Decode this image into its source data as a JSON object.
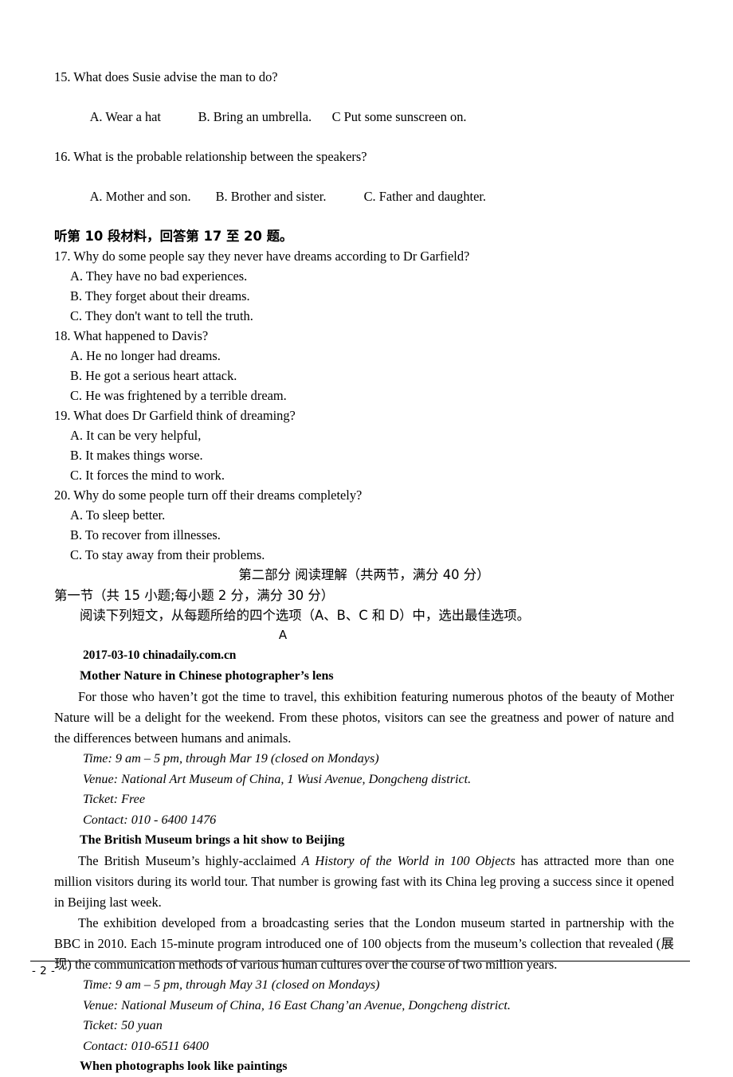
{
  "document": {
    "page_number_label": "- 2 -"
  },
  "listening": {
    "questions": [
      {
        "number": "15.",
        "text": "15. What does Susie advise the man to do?",
        "options": [
          "A. Wear a hat",
          "B. Bring an umbrella.",
          "C Put some sunscreen on."
        ],
        "inline": true
      },
      {
        "number": "16.",
        "text": "16. What is the probable relationship between the speakers?",
        "options": [
          "A. Mother and son.",
          "B. Brother and sister.",
          "C. Father and daughter."
        ],
        "inline": true
      }
    ],
    "instruction_10": "听第 10 段材料，回答第 17 至 20 题。",
    "q17": {
      "stem": "17. Why do some people say they never have dreams according to Dr Garfield?",
      "a": "A. They have no bad experiences.",
      "b": "B. They forget about their dreams.",
      "c": "C. They don't want to tell the truth."
    },
    "q18": {
      "stem": "18. What happened to Davis?",
      "a": "A. He no longer had dreams.",
      "b": "B. He got a serious heart attack.",
      "c": "C. He was frightened by a terrible dream."
    },
    "q19": {
      "stem": "19. What does Dr Garfield think of dreaming?",
      "a": "A. It can be very helpful,",
      "b": "B. It makes things worse.",
      "c": "C. It forces the mind to work."
    },
    "q20": {
      "stem": "20. Why do some people turn off their dreams completely?",
      "a": "A. To sleep better.",
      "b": "B. To recover from illnesses.",
      "c": "C. To stay away from their problems."
    }
  },
  "part_two": {
    "heading": "第二部分   阅读理解（共两节，满分 40 分）",
    "section_one": "第一节（共 15 小题;每小题 2 分，满分 30 分）",
    "section_one_instruction": "阅读下列短文，从每题所给的四个选项（A、B、C 和 D）中，选出最佳选项。",
    "passage_letter": "A"
  },
  "passage_a": {
    "source": "2017-03-10 chinadaily.com.cn",
    "heading1": "Mother Nature in Chinese photographer’s lens",
    "para1": "For those who haven’t got the time to travel, this exhibition featuring numerous photos of the beauty of Mother Nature will be a delight for the weekend. From these photos, visitors can see the greatness and power of nature and the differences between humans and animals.",
    "info1": {
      "time": "Time: 9 am – 5 pm, through Mar 19 (closed on Mondays)",
      "venue": "Venue: National Art Museum of China, 1 Wusi Avenue, Dongcheng district.",
      "ticket": "Ticket: Free",
      "contact": "Contact: 010 - 6400 1476"
    },
    "heading2": "The British Museum brings a hit show to Beijing",
    "para2_before": "The British Museum’s highly-acclaimed ",
    "para2_italic": "A History of the World in 100 Objects",
    "para2_after": " has attracted more than one million visitors during its world tour. That number is growing fast with its China leg proving a success since it opened in Beijing last week.",
    "para3": "The exhibition developed from a broadcasting series that the London museum started in partnership with the BBC in 2010. Each 15-minute program introduced one of 100 objects from the museum’s collection that revealed (展现) the communication methods of various human cultures over the course of two million years.",
    "info2": {
      "time": "Time: 9 am – 5 pm, through May 31 (closed on Mondays)",
      "venue": "Venue: National Museum of China, 16 East Chang’an Avenue, Dongcheng district.",
      "ticket": "Ticket: 50 yuan",
      "contact": "Contact: 010-6511 6400"
    },
    "heading3": "When photographs look like paintings"
  }
}
